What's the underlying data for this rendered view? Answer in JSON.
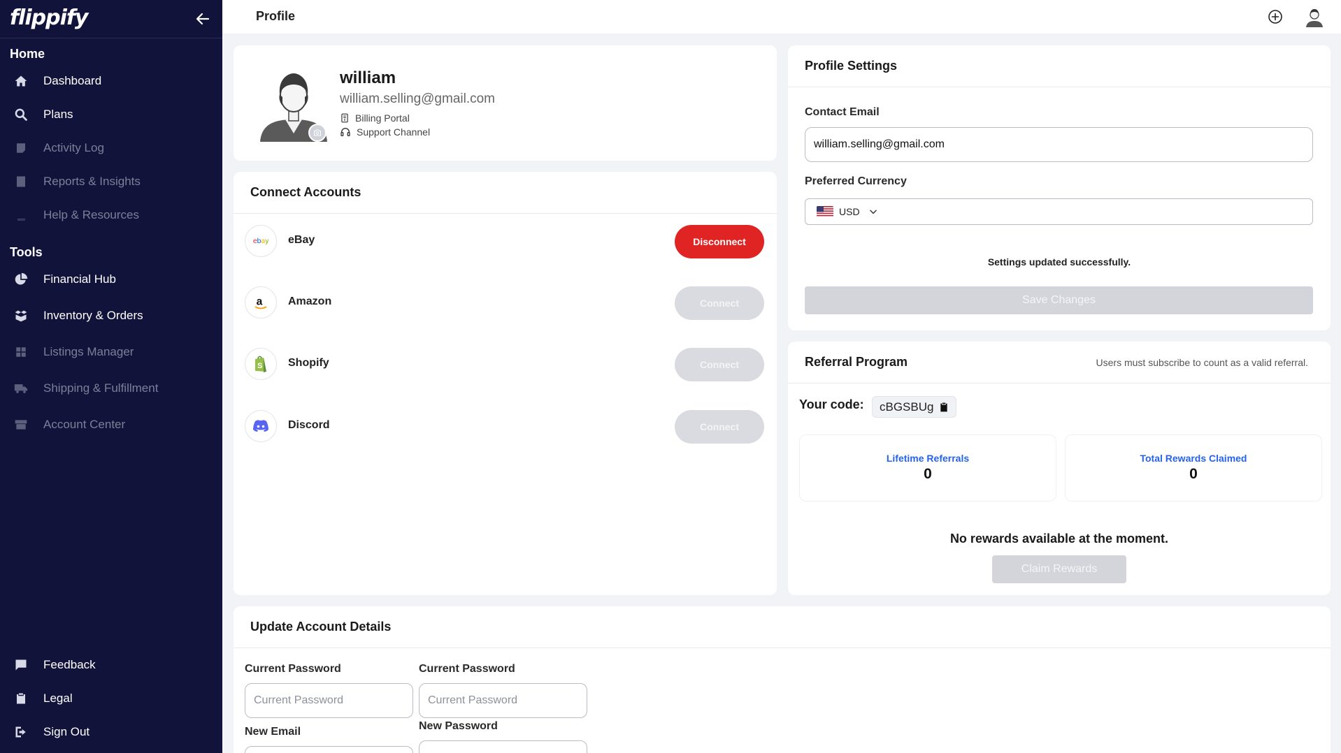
{
  "app": {
    "logo": "flippify",
    "page_title": "Profile"
  },
  "sidebar": {
    "home_section": "Home",
    "tools_section": "Tools",
    "home_items": [
      {
        "label": "Dashboard",
        "icon": "home-icon"
      },
      {
        "label": "Plans",
        "icon": "search-icon"
      },
      {
        "label": "Activity Log",
        "icon": "activity-log-icon"
      },
      {
        "label": "Reports & Insights",
        "icon": "reports-icon"
      },
      {
        "label": "Help & Resources",
        "icon": "book-icon"
      }
    ],
    "tools_items": [
      {
        "label": "Financial Hub",
        "icon": "pie-chart-icon"
      },
      {
        "label": "Inventory & Orders",
        "icon": "box-icon"
      },
      {
        "label": "Listings Manager",
        "icon": "grid-icon"
      },
      {
        "label": "Shipping & Fulfillment",
        "icon": "truck-icon"
      },
      {
        "label": "Account Center",
        "icon": "store-icon"
      }
    ],
    "bottom_items": [
      {
        "label": "Feedback",
        "icon": "feedback-icon"
      },
      {
        "label": "Legal",
        "icon": "clipboard-icon"
      },
      {
        "label": "Sign Out",
        "icon": "sign-out-icon"
      }
    ]
  },
  "profile": {
    "name": "william",
    "email": "william.selling@gmail.com",
    "billing_portal": "Billing Portal",
    "support_channel": "Support Channel"
  },
  "connect_accounts": {
    "title": "Connect Accounts",
    "accounts": [
      {
        "name": "eBay",
        "button": "Disconnect",
        "connected": true
      },
      {
        "name": "Amazon",
        "button": "Connect",
        "connected": false
      },
      {
        "name": "Shopify",
        "button": "Connect",
        "connected": false
      },
      {
        "name": "Discord",
        "button": "Connect",
        "connected": false
      }
    ]
  },
  "profile_settings": {
    "title": "Profile Settings",
    "contact_email_label": "Contact Email",
    "contact_email_value": "william.selling@gmail.com",
    "currency_label": "Preferred Currency",
    "currency_value": "USD",
    "status_message": "Settings updated successfully.",
    "save_button": "Save Changes"
  },
  "referral": {
    "title": "Referral Program",
    "note": "Users must subscribe to count as a valid referral.",
    "code_label": "Your code:",
    "code": "cBGSBUg",
    "lifetime_label": "Lifetime Referrals",
    "lifetime_value": "0",
    "rewards_label": "Total Rewards Claimed",
    "rewards_value": "0",
    "empty_message": "No rewards available at the moment.",
    "claim_button": "Claim Rewards"
  },
  "update_account": {
    "title": "Update Account Details",
    "col1_label1": "Current Password",
    "col1_placeholder1": "Current Password",
    "col1_label2": "New Email",
    "col2_label1": "Current Password",
    "col2_placeholder1": "Current Password",
    "col2_label2": "New Password"
  },
  "colors": {
    "sidebar": "#12133a",
    "danger": "#e02424",
    "link": "#2563eb",
    "disabled": "#d3d5da"
  }
}
